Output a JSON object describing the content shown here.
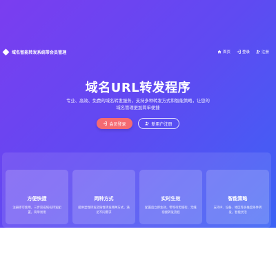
{
  "navbar": {
    "brand_icon": "diamond-logo-icon",
    "brand_title": "域名智能转发系统带会员管理",
    "links": [
      {
        "icon": "home-icon",
        "label": "首页"
      },
      {
        "icon": "login-icon",
        "label": "登录"
      },
      {
        "icon": "user-plus-icon",
        "label": "注册"
      }
    ]
  },
  "hero": {
    "title": "域名URL转发程序",
    "description_line1": "专业、高效、免费的域名转发服务，支持多种转发方式和智能策略，让您的",
    "description_line2": "域名管理更加简单便捷",
    "login_button": {
      "icon": "login-icon",
      "label": "会员登录"
    },
    "register_button": {
      "icon": "user-plus-icon",
      "label": "新用户注册"
    }
  },
  "features": [
    {
      "title": "方便快捷",
      "description": "注册即可使用，三步完成域名转发配置，简单易用"
    },
    {
      "title": "两种方式",
      "description": "提供显性转发及隐性转发两种方式，满足不同需求"
    },
    {
      "title": "实时生效",
      "description": "配置后立即生效，零等待无缝衔，无缝衔接转发流程"
    },
    {
      "title": "智能策略",
      "description": "支持IP、设备、地区等多维度条件转发，智能灵活"
    }
  ],
  "colors": {
    "gradient_start": "#7b3df0",
    "gradient_end": "#3b63f5",
    "login_button": "#f46a72"
  }
}
